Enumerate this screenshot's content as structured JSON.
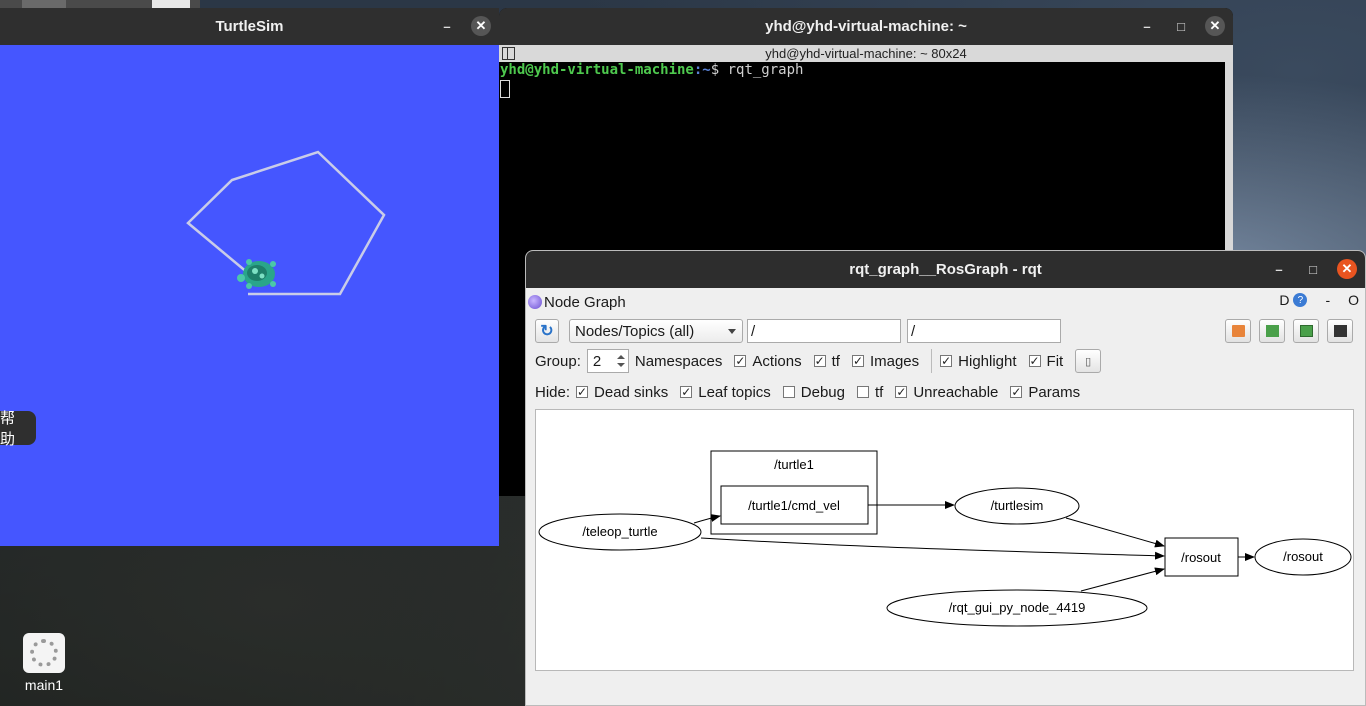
{
  "turtlesim": {
    "title": "TurtleSim",
    "help_label": "帮助",
    "background_color": "#4556ff"
  },
  "terminal": {
    "title": "yhd@yhd-virtual-machine: ~",
    "subtitle": "yhd@yhd-virtual-machine: ~ 80x24",
    "prompt_user": "yhd@yhd-virtual-machine",
    "prompt_path": ":~",
    "prompt_symbol": "$ ",
    "command": "rqt_graph"
  },
  "rqt": {
    "title": "rqt_graph__RosGraph - rqt",
    "plugin_title": "Node Graph",
    "plugin_d": "D",
    "plugin_help": "?",
    "plugin_dash": "-",
    "plugin_o": "O",
    "view_mode": "Nodes/Topics (all)",
    "filter_1": "/",
    "filter_2": "/",
    "group_label": "Group:",
    "group_value": "2",
    "group_options": [
      {
        "label": "Namespaces",
        "checked": true
      },
      {
        "label": "Actions",
        "checked": true
      },
      {
        "label": "tf",
        "checked": true
      },
      {
        "label": "Images",
        "checked": true
      }
    ],
    "highlight": {
      "label": "Highlight",
      "checked": true
    },
    "fit": {
      "label": "Fit",
      "checked": true
    },
    "hide_label": "Hide:",
    "hide_options": [
      {
        "label": "Dead sinks",
        "checked": true
      },
      {
        "label": "Leaf topics",
        "checked": true
      },
      {
        "label": "Debug",
        "checked": false
      },
      {
        "label": "tf",
        "checked": false
      },
      {
        "label": "Unreachable",
        "checked": true
      },
      {
        "label": "Params",
        "checked": true
      }
    ],
    "graph": {
      "namespace_box": "/turtle1",
      "nodes": {
        "teleop": "/teleop_turtle",
        "cmd_vel": "/turtle1/cmd_vel",
        "turtlesim": "/turtlesim",
        "rosout_topic": "/rosout",
        "rosout_node": "/rosout",
        "rqt_gui": "/rqt_gui_py_node_4419"
      }
    }
  },
  "dock": {
    "label": "main1",
    "icon": "gear-icon"
  },
  "window_controls": {
    "minimize": "–",
    "maximize": "□",
    "close": "✕"
  }
}
